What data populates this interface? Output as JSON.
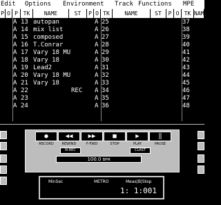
{
  "menu": [
    "Edit",
    "Options",
    "Environment",
    "Track",
    "Functions",
    "MPE"
  ],
  "columns": {
    "p": "P",
    "o": "O",
    "tk": "TK",
    "name": "NAME",
    "st": "ST"
  },
  "tracks": [
    {
      "no": "13",
      "name": "autopan",
      "st": "",
      "mode": "A"
    },
    {
      "no": "14",
      "name": "mix list",
      "st": "",
      "mode": "A"
    },
    {
      "no": "15",
      "name": "composed",
      "st": "",
      "mode": "A"
    },
    {
      "no": "16",
      "name": "T.Conrar",
      "st": "",
      "mode": "A"
    },
    {
      "no": "17",
      "name": "Vary 18  MU",
      "st": "",
      "mode": "A"
    },
    {
      "no": "18",
      "name": "Vary 18",
      "st": "",
      "mode": "A"
    },
    {
      "no": "19",
      "name": "Lead2",
      "st": "",
      "mode": "A"
    },
    {
      "no": "20",
      "name": "Vary 18  MU",
      "st": "",
      "mode": "A"
    },
    {
      "no": "21",
      "name": "Vary 18",
      "st": "",
      "mode": "A"
    },
    {
      "no": "22",
      "name": "",
      "st": "REC",
      "mode": "A"
    },
    {
      "no": "23",
      "name": "",
      "st": "",
      "mode": "A"
    },
    {
      "no": "24",
      "name": "",
      "st": "",
      "mode": "A"
    }
  ],
  "col1_modes": [
    "A",
    "A",
    "A",
    "A",
    "A",
    "A",
    "A",
    "A",
    "A",
    "A",
    "A",
    "A"
  ],
  "col3_numbers": [
    "25",
    "26",
    "27",
    "28",
    "29",
    "30",
    "31",
    "32",
    "33",
    "34",
    "35",
    "36"
  ],
  "col4_numbers": [
    "37",
    "38",
    "39",
    "40",
    "41",
    "42",
    "43",
    "44",
    "45",
    "46",
    "47",
    "48"
  ],
  "transport": {
    "buttons": [
      {
        "glyph": "●",
        "label": "RECORD"
      },
      {
        "glyph": "◀◀",
        "label": "REWIND"
      },
      {
        "glyph": "▶▶",
        "label": "F-FWD"
      },
      {
        "glyph": "■",
        "label": "STOP"
      },
      {
        "glyph": "▶",
        "label": "PLAY"
      },
      {
        "glyph": "‖",
        "label": "PAUSE"
      }
    ],
    "small_buttons": [
      "N-REC",
      "CLAST"
    ],
    "tempo": "100.0",
    "tempo_unit": "BPM",
    "counter_left": "MinSec",
    "counter_mid": "METRO",
    "counter_right": "Meas|B|Step",
    "counter_value": "1: 1:001"
  }
}
